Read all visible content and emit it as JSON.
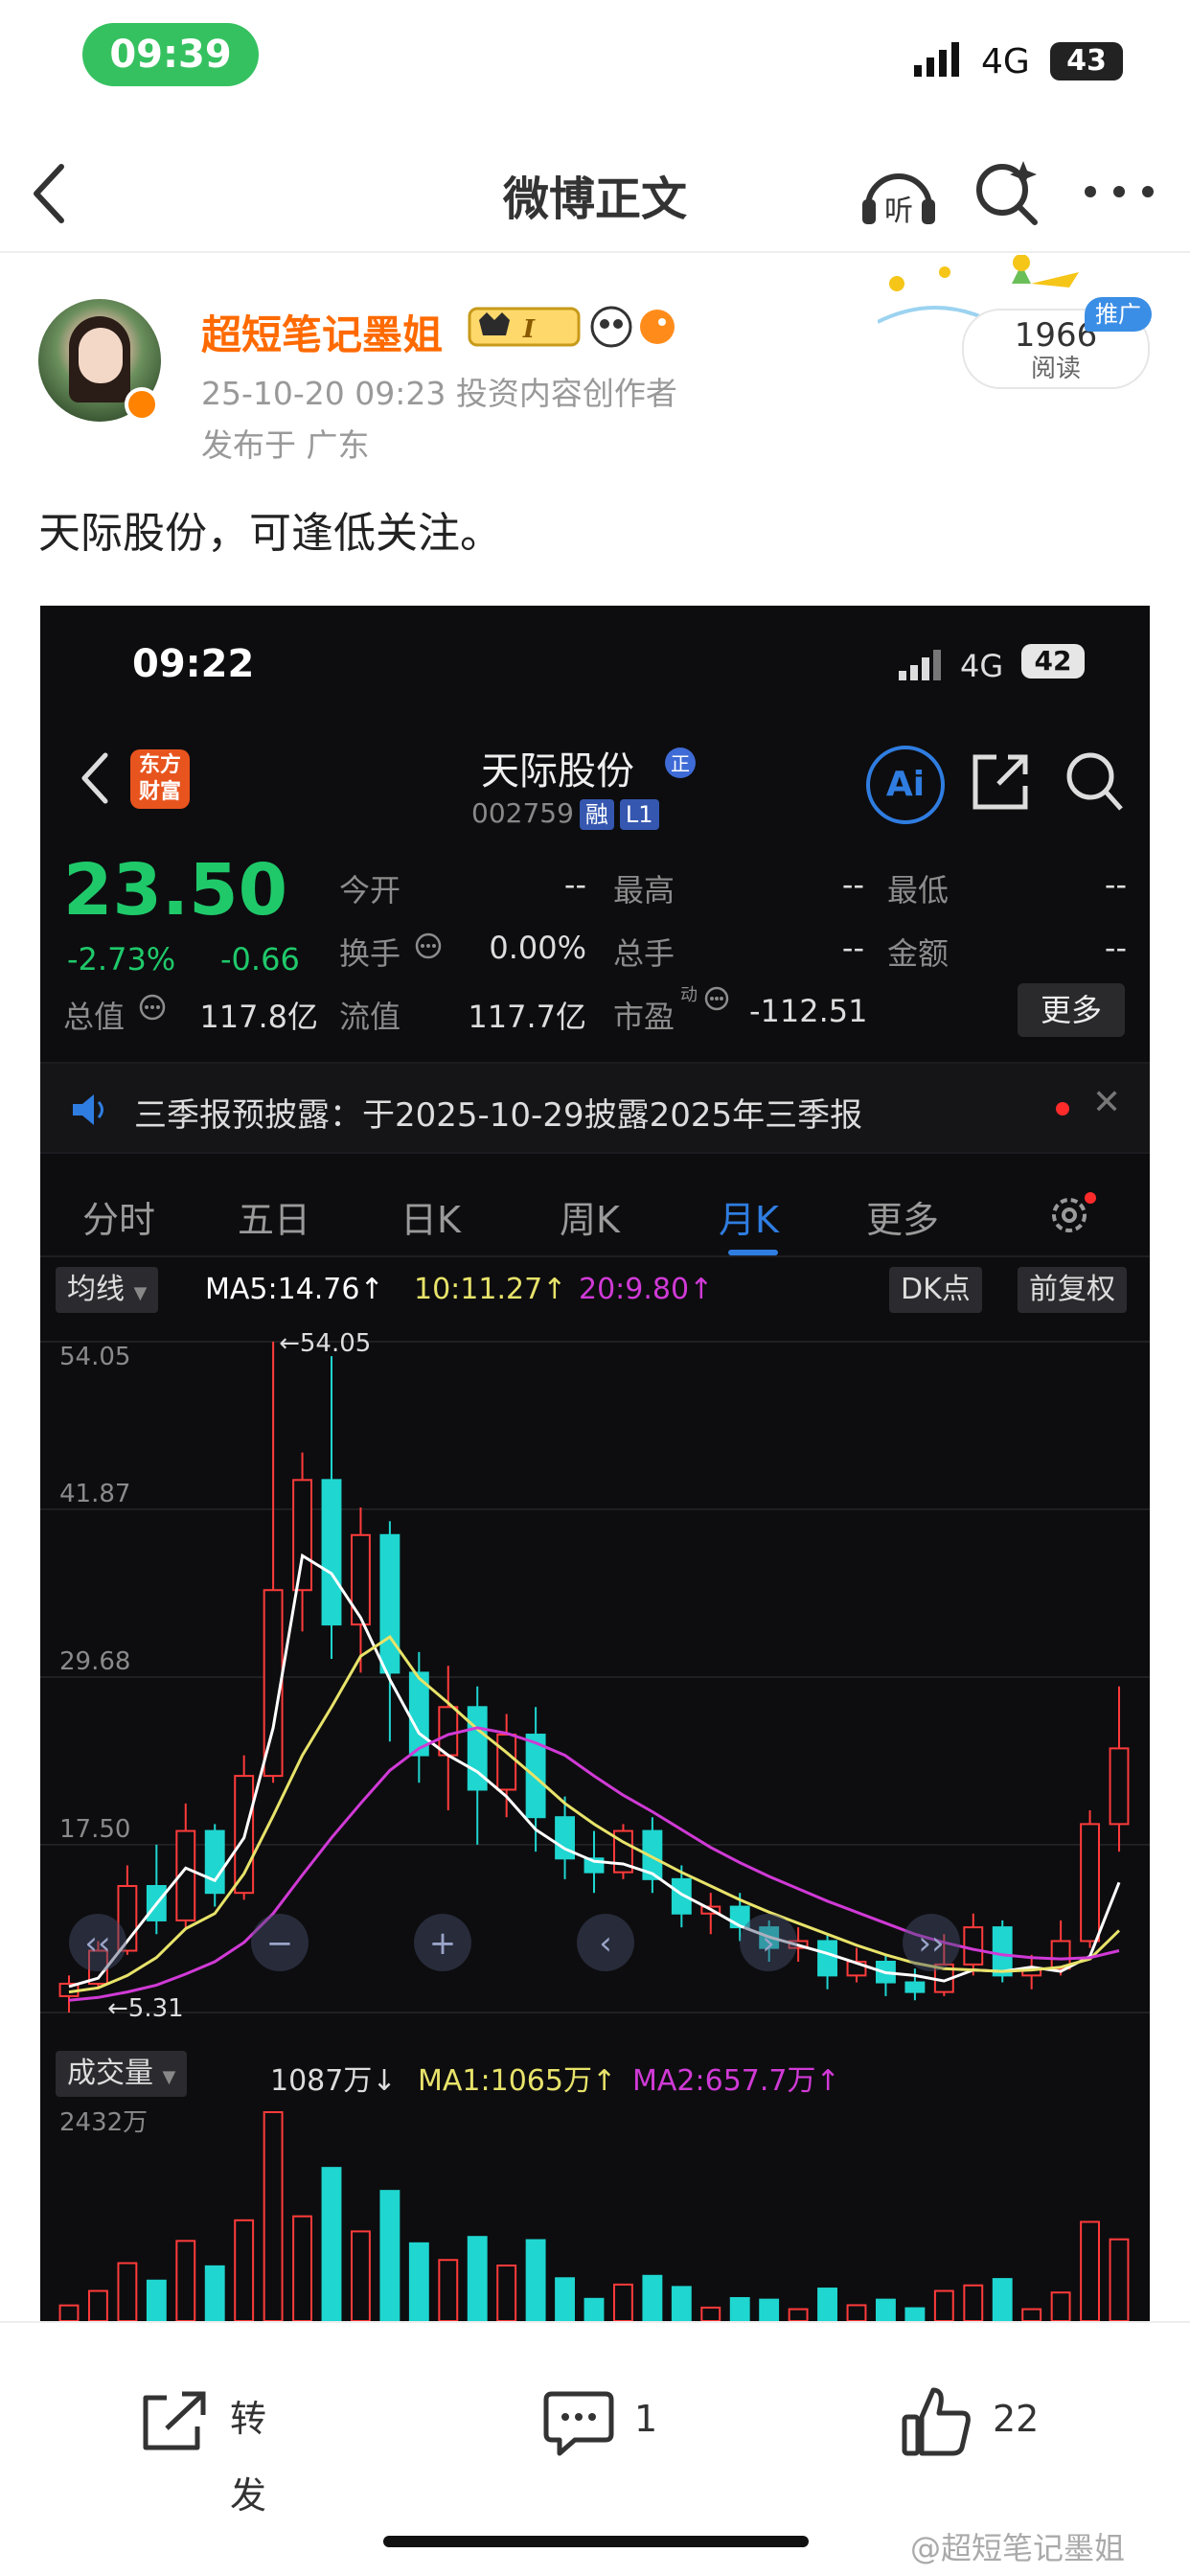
{
  "status": {
    "time": "09:39",
    "network": "4G",
    "battery": "43"
  },
  "nav": {
    "title": "微博正文"
  },
  "post": {
    "author": "超短笔记墨姐",
    "meta": "25-10-20 09:23  投资内容创作者",
    "location": "发布于 广东",
    "read_count": "1966",
    "read_label": "阅读",
    "promo_tag": "推广",
    "text": "天际股份，可逢低关注。"
  },
  "shot": {
    "time": "09:22",
    "network": "4G",
    "battery": "42",
    "app_logo": "东方财富",
    "stock_name": "天际股份",
    "stock_code": "002759",
    "tag_rong": "融",
    "tag_l1": "L1",
    "ai_label": "Ai",
    "price": "23.50",
    "change_pct": "-2.73%",
    "change_amt": "-0.66",
    "quote": [
      {
        "label": "今开",
        "value": "--"
      },
      {
        "label": "最高",
        "value": "--"
      },
      {
        "label": "最低",
        "value": "--"
      },
      {
        "label": "换手",
        "value": "0.00%"
      },
      {
        "label": "总手",
        "value": "--"
      },
      {
        "label": "金额",
        "value": "--"
      },
      {
        "label": "总值",
        "value": "117.8亿"
      },
      {
        "label": "流值",
        "value": "117.7亿"
      },
      {
        "label": "市盈",
        "value": "-112.51"
      }
    ],
    "more_btn": "更多",
    "notice": "三季报预披露：于2025-10-29披露2025年三季报",
    "tabs": [
      "分时",
      "五日",
      "日K",
      "周K",
      "月K",
      "更多"
    ],
    "active_tab": "月K",
    "ma_selector": "均线",
    "ma5": "MA5:14.76↑",
    "ma10": "10:11.27↑",
    "ma20": "20:9.80↑",
    "dk_btn": "DK点",
    "fq_btn": "前复权",
    "vol_selector": "成交量",
    "vol_value": "1087万↓",
    "vol_ma1": "MA1:1065万↑",
    "vol_ma2": "MA2:657.7万↑",
    "colors": {
      "up": "#ff3b3b",
      "down": "#1fd6d0",
      "ma5": "#ffffff",
      "ma10": "#e8e36a",
      "ma20": "#d03ad6",
      "price_green": "#1fc96a",
      "accent": "#2f7de1"
    }
  },
  "chart_data": {
    "type": "line",
    "title": "",
    "price_axis_ticks": [
      "54.05",
      "41.87",
      "29.68",
      "17.50"
    ],
    "vol_axis_top": "2432万",
    "annotations": [
      "←54.05",
      "←5.31"
    ],
    "ylim": [
      5.31,
      54.05
    ],
    "series": [
      {
        "name": "MA5",
        "values": [
          7.2,
          7.8,
          10.5,
          13.2,
          15.8,
          14.9,
          18.0,
          26.0,
          38.5,
          37.2,
          34.0,
          29.5,
          25.6,
          24.0,
          22.8,
          21.0,
          18.6,
          17.2,
          16.3,
          16.1,
          15.4,
          13.9,
          12.8,
          11.6,
          10.8,
          10.2,
          9.6,
          8.9,
          8.2,
          8.0,
          7.6,
          8.4,
          8.3,
          8.6,
          8.3,
          9.4,
          14.76
        ]
      },
      {
        "name": "10",
        "values": [
          6.8,
          7.1,
          8.0,
          9.3,
          11.4,
          12.5,
          15.4,
          19.6,
          24.0,
          27.5,
          31.2,
          32.6,
          29.6,
          27.8,
          25.9,
          24.2,
          22.4,
          20.5,
          19.0,
          17.7,
          16.6,
          15.5,
          14.5,
          13.5,
          12.6,
          11.8,
          11.0,
          10.2,
          9.5,
          8.9,
          8.5,
          8.4,
          8.3,
          8.4,
          8.6,
          9.2,
          11.27
        ]
      },
      {
        "name": "20",
        "values": [
          6.2,
          6.4,
          6.8,
          7.3,
          8.1,
          9.0,
          10.4,
          12.5,
          15.3,
          18.0,
          20.5,
          22.9,
          24.5,
          25.5,
          26.0,
          25.6,
          24.9,
          24.0,
          22.5,
          21.1,
          19.9,
          18.6,
          17.3,
          16.2,
          15.2,
          14.3,
          13.4,
          12.6,
          11.8,
          11.0,
          10.4,
          9.9,
          9.5,
          9.3,
          9.2,
          9.3,
          9.8
        ]
      }
    ],
    "candles": [
      {
        "o": 6.5,
        "c": 7.4,
        "h": 8.0,
        "l": 5.31
      },
      {
        "o": 7.4,
        "c": 9.8,
        "h": 10.5,
        "l": 7.0
      },
      {
        "o": 9.8,
        "c": 14.5,
        "h": 16.0,
        "l": 9.5
      },
      {
        "o": 14.5,
        "c": 12.0,
        "h": 17.5,
        "l": 11.0
      },
      {
        "o": 12.0,
        "c": 18.5,
        "h": 20.5,
        "l": 11.5
      },
      {
        "o": 18.5,
        "c": 14.0,
        "h": 19.0,
        "l": 13.0
      },
      {
        "o": 14.0,
        "c": 22.5,
        "h": 24.0,
        "l": 13.5
      },
      {
        "o": 22.5,
        "c": 36.0,
        "h": 54.05,
        "l": 22.0
      },
      {
        "o": 36.0,
        "c": 44.0,
        "h": 46.0,
        "l": 33.0
      },
      {
        "o": 44.0,
        "c": 33.5,
        "h": 53.0,
        "l": 31.0
      },
      {
        "o": 33.5,
        "c": 40.0,
        "h": 42.0,
        "l": 30.0
      },
      {
        "o": 40.0,
        "c": 30.0,
        "h": 41.0,
        "l": 25.0
      },
      {
        "o": 30.0,
        "c": 24.0,
        "h": 31.5,
        "l": 22.0
      },
      {
        "o": 24.0,
        "c": 27.5,
        "h": 30.5,
        "l": 20.0
      },
      {
        "o": 27.5,
        "c": 21.5,
        "h": 29.0,
        "l": 17.5
      },
      {
        "o": 21.5,
        "c": 25.5,
        "h": 27.0,
        "l": 19.5
      },
      {
        "o": 25.5,
        "c": 19.5,
        "h": 27.5,
        "l": 17.0
      },
      {
        "o": 19.5,
        "c": 16.5,
        "h": 21.0,
        "l": 15.0
      },
      {
        "o": 16.5,
        "c": 15.5,
        "h": 18.5,
        "l": 14.0
      },
      {
        "o": 15.5,
        "c": 18.5,
        "h": 19.0,
        "l": 15.0
      },
      {
        "o": 18.5,
        "c": 15.0,
        "h": 19.5,
        "l": 14.0
      },
      {
        "o": 15.0,
        "c": 12.5,
        "h": 16.0,
        "l": 11.5
      },
      {
        "o": 12.5,
        "c": 13.0,
        "h": 14.0,
        "l": 11.0
      },
      {
        "o": 13.0,
        "c": 11.5,
        "h": 14.0,
        "l": 10.5
      },
      {
        "o": 11.5,
        "c": 10.0,
        "h": 12.0,
        "l": 9.0
      },
      {
        "o": 10.0,
        "c": 10.5,
        "h": 11.5,
        "l": 9.0
      },
      {
        "o": 10.5,
        "c": 8.0,
        "h": 11.0,
        "l": 7.0
      },
      {
        "o": 8.0,
        "c": 9.0,
        "h": 10.0,
        "l": 7.5
      },
      {
        "o": 9.0,
        "c": 7.5,
        "h": 9.5,
        "l": 6.5
      },
      {
        "o": 7.5,
        "c": 6.8,
        "h": 8.5,
        "l": 6.2
      },
      {
        "o": 6.8,
        "c": 8.8,
        "h": 11.0,
        "l": 6.5
      },
      {
        "o": 8.8,
        "c": 11.5,
        "h": 12.5,
        "l": 8.0
      },
      {
        "o": 11.5,
        "c": 8.0,
        "h": 12.0,
        "l": 7.5
      },
      {
        "o": 8.0,
        "c": 8.5,
        "h": 9.5,
        "l": 7.0
      },
      {
        "o": 8.5,
        "c": 10.5,
        "h": 12.0,
        "l": 8.0
      },
      {
        "o": 10.5,
        "c": 19.0,
        "h": 20.0,
        "l": 10.0
      },
      {
        "o": 19.0,
        "c": 24.5,
        "h": 29.0,
        "l": 17.0
      }
    ]
  },
  "bottom": {
    "repost": "转发",
    "comment_count": "1",
    "like_count": "22",
    "watermark": "@超短笔记墨姐"
  }
}
